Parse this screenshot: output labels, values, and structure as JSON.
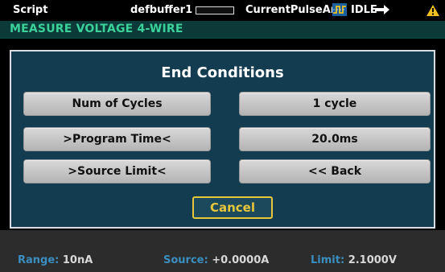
{
  "status_bar": {
    "script_label": "Script",
    "buffer_name": "defbuffer1",
    "script_name": "CurrentPulseAnd",
    "state": "IDLE",
    "trigger_icon": "trigger-icon",
    "idle_icon": "idle-arrow-icon",
    "warning_icon": "warning-icon",
    "warning_color": "#f0c020"
  },
  "function_bar": {
    "label": "MEASURE VOLTAGE 4-WIRE",
    "color": "#3ad29a"
  },
  "dialog": {
    "title": "End Conditions",
    "rows": [
      {
        "left": "Num of Cycles",
        "right": "1 cycle"
      },
      {
        "left": ">Program Time<",
        "right": "20.0ms"
      },
      {
        "left": ">Source Limit<",
        "right": "<< Back"
      }
    ],
    "cancel_label": "Cancel"
  },
  "bottom_bar": {
    "range_label": "Range:",
    "range_value": "10nA",
    "source_label": "Source:",
    "source_value": "+0.0000A",
    "limit_label": "Limit:",
    "limit_value": "2.1000V"
  }
}
